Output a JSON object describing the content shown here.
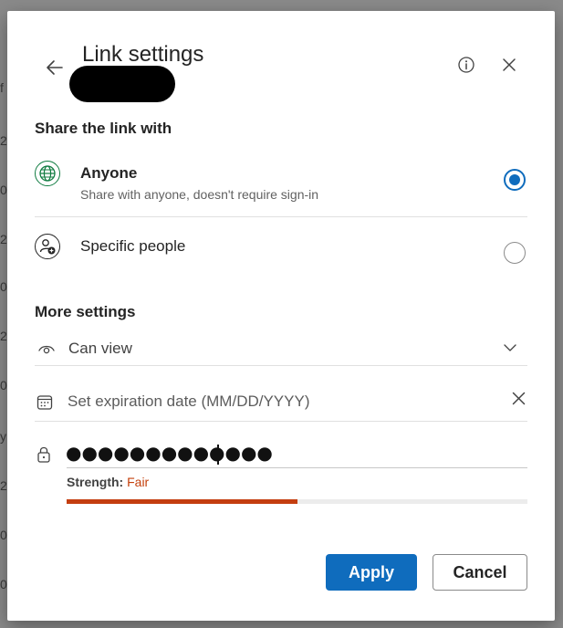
{
  "dialog": {
    "title": "Link settings",
    "share_heading": "Share the link with",
    "options": [
      {
        "title": "Anyone",
        "description": "Share with anyone, doesn't require sign-in",
        "selected": true,
        "icon": "globe-icon"
      },
      {
        "title": "Specific people",
        "selected": false,
        "icon": "person-add-icon"
      }
    ],
    "more_settings": {
      "heading": "More settings",
      "permission": "Can view",
      "expiration_placeholder": "Set expiration date (MM/DD/YYYY)",
      "password_value": "●●●●●●●●●●●●●",
      "strength_label": "Strength:",
      "strength_value": "Fair",
      "strength_level": 0.5
    },
    "buttons": {
      "apply": "Apply",
      "cancel": "Cancel"
    }
  },
  "colors": {
    "accent": "#0f6cbd",
    "strength_fair": "#c43e10",
    "globe_green": "#107c41"
  }
}
